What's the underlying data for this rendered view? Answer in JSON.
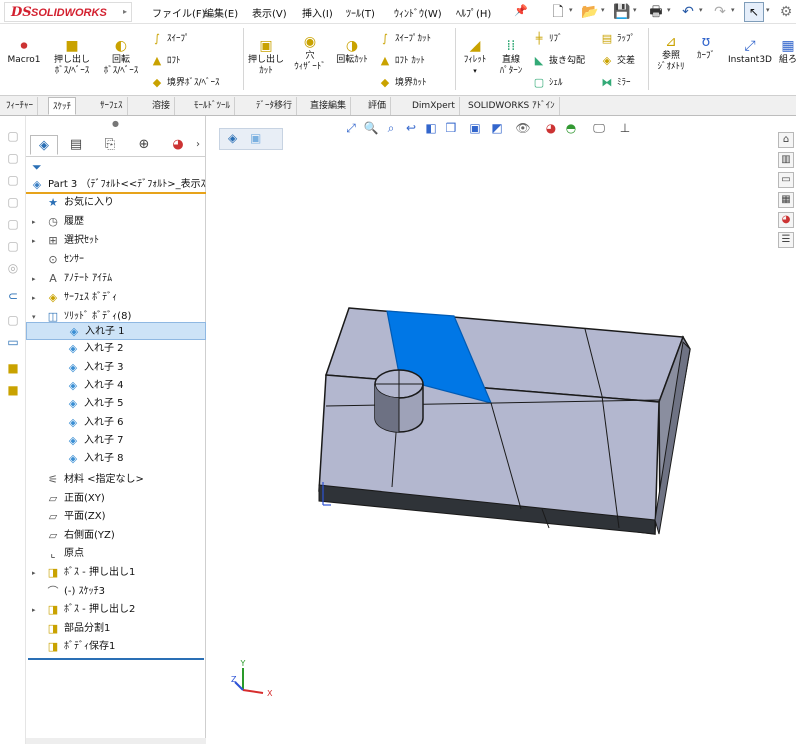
{
  "app": {
    "logo_mark": "DS",
    "logo_text": "SOLIDWORKS",
    "accent": "#d3202f"
  },
  "menu": [
    "ファイル(F)",
    "編集(E)",
    "表示(V)",
    "挿入(I)",
    "ﾂｰﾙ(T)",
    "ｳｨﾝﾄﾞｳ(W)",
    "ﾍﾙﾌﾟ(H)"
  ],
  "ribbon": {
    "macro": "Macro1",
    "extrude_boss_1": "押し出し",
    "extrude_boss_2": "ﾎﾞｽ/ﾍﾞｰｽ",
    "revolve_boss_1": "回転",
    "revolve_boss_2": "ﾎﾞｽ/ﾍﾞｰｽ",
    "sweep": "ｽｲｰﾌﾟ",
    "loft": "ﾛﾌﾄ",
    "boundary_boss": "境界ﾎﾞｽ/ﾍﾞｰｽ",
    "extrude_cut_1": "押し出し",
    "extrude_cut_2": "ｶｯﾄ",
    "wizard_1": "穴",
    "wizard_2": "ｳｨｻﾞｰﾄﾞ",
    "revolve_cut": "回転ｶｯﾄ",
    "sweep_cut": "ｽｲｰﾌﾟｶｯﾄ",
    "loft_cut": "ﾛﾌﾄ ｶｯﾄ",
    "boundary_cut": "境界ｶｯﾄ",
    "fillet": "ﾌｨﾚｯﾄ",
    "linear_pattern_1": "直線",
    "linear_pattern_2": "ﾊﾟﾀｰﾝ",
    "rib": "ﾘﾌﾞ",
    "draft": "抜き勾配",
    "shell": "ｼｪﾙ",
    "wrap": "ﾗｯﾌﾟ",
    "intersect": "交差",
    "mirror": "ﾐﾗｰ",
    "ref_geom_1": "参照",
    "ref_geom_2": "ｼﾞｵﾒﾄﾘ",
    "curves": "ｶｰﾌﾞ",
    "instant3d": "Instant3D",
    "trailing": "組ろ"
  },
  "tabs": [
    "ﾌｨｰﾁｬｰ",
    "ｽｹｯﾁ",
    "ｻｰﾌｪｽ",
    "溶接",
    "ﾓｰﾙﾄﾞﾂｰﾙ",
    "ﾃﾞｰﾀ移行",
    "直接編集",
    "評価",
    "DimXpert",
    "SOLIDWORKS ｱﾄﾞｲﾝ"
  ],
  "active_tab_index": 1,
  "tree": {
    "root": "Part 3 （ﾃﾞﾌｫﾙﾄ<<ﾃﾞﾌｫﾙﾄ>_表示ｽ",
    "items": [
      {
        "label": "お気に入り",
        "icon": "favorites-icon"
      },
      {
        "label": "履歴",
        "icon": "history-icon"
      },
      {
        "label": "選択ｾｯﾄ",
        "icon": "selection-set-icon"
      },
      {
        "label": "ｾﾝｻｰ",
        "icon": "sensor-icon"
      },
      {
        "label": "ｱﾉﾃｰﾄ ｱｲﾃﾑ",
        "icon": "annotations-icon"
      },
      {
        "label": "ｻｰﾌｪｽ ﾎﾞﾃﾞｨ",
        "icon": "surface-bodies-icon"
      },
      {
        "label": "ｿﾘｯﾄﾞ ﾎﾞﾃﾞｨ(8)",
        "icon": "solid-bodies-icon"
      }
    ],
    "bodies": [
      "入れ子 1",
      "入れ子 2",
      "入れ子 3",
      "入れ子 4",
      "入れ子 5",
      "入れ子 6",
      "入れ子 7",
      "入れ子 8"
    ],
    "items2": [
      {
        "label": "材料 <指定なし>",
        "icon": "material-icon"
      },
      {
        "label": "正面(XY)",
        "icon": "plane-icon"
      },
      {
        "label": "平面(ZX)",
        "icon": "plane-icon"
      },
      {
        "label": "右側面(YZ)",
        "icon": "plane-icon"
      },
      {
        "label": "原点",
        "icon": "origin-icon"
      },
      {
        "label": "ﾎﾞｽ - 押し出し1",
        "icon": "extrude-icon"
      },
      {
        "label": "(-) ｽｹｯﾁ3",
        "icon": "sketch-icon"
      },
      {
        "label": "ﾎﾞｽ - 押し出し2",
        "icon": "extrude-icon"
      },
      {
        "label": "部品分割1",
        "icon": "split-icon"
      },
      {
        "label": "ﾎﾞﾃﾞｨ保存1",
        "icon": "save-bodies-icon"
      }
    ]
  },
  "triad": {
    "x": "X",
    "y": "Y",
    "z": "Z"
  },
  "colors": {
    "face": "#b3b7cf",
    "side": "#8a8e9f",
    "front": "#2f3338",
    "highlight": "#0077e6",
    "edge": "#1a1a1a"
  }
}
